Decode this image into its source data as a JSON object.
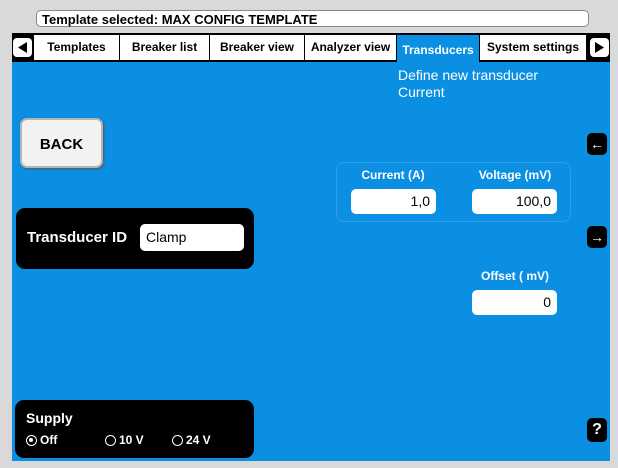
{
  "header": {
    "template_label": "Template selected: MAX CONFIG TEMPLATE"
  },
  "tabs": [
    {
      "label": "Templates"
    },
    {
      "label": "Breaker list"
    },
    {
      "label": "Breaker view"
    },
    {
      "label": "Analyzer view"
    },
    {
      "label": "Transducers",
      "active": true
    },
    {
      "label": "System settings"
    }
  ],
  "page": {
    "subtitle_line1": "Define new transducer",
    "subtitle_line2": "Current"
  },
  "back_button": {
    "label": "BACK"
  },
  "side_buttons": {
    "prev_label": "←",
    "next_label": "→",
    "help_label": "?"
  },
  "transducer": {
    "id_label": "Transducer ID",
    "id_value": "Clamp"
  },
  "measurements": {
    "current_label": "Current  (A)",
    "current_value": "1,0",
    "voltage_label": "Voltage (mV)",
    "voltage_value": "100,0",
    "offset_label": "Offset ( mV)",
    "offset_value": "0"
  },
  "supply": {
    "title": "Supply",
    "options": [
      {
        "label": "Off",
        "selected": true
      },
      {
        "label": "10 V",
        "selected": false
      },
      {
        "label": "24 V",
        "selected": false
      }
    ]
  },
  "colors": {
    "accent": "#0a8fe3",
    "panel": "#000000",
    "chrome": "#d9d9d9"
  }
}
